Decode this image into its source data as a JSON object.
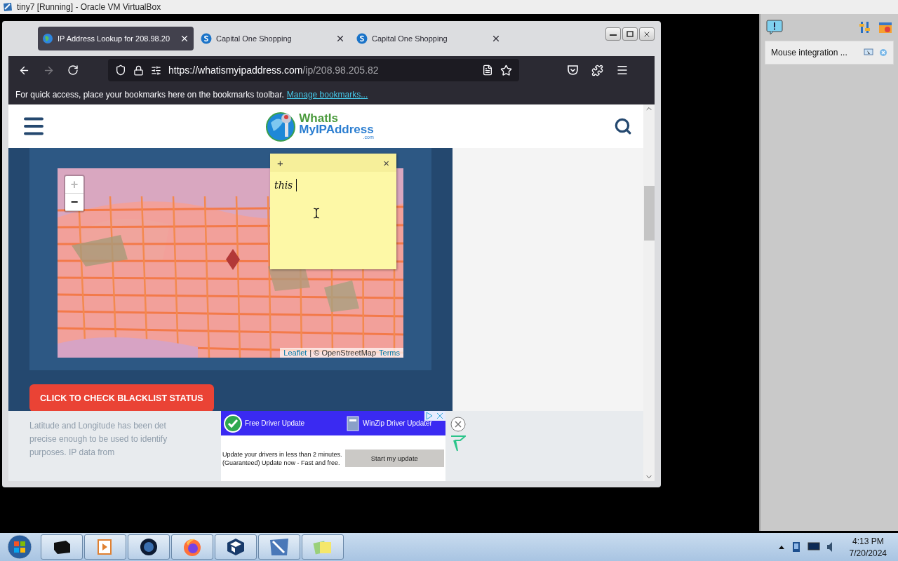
{
  "vbox": {
    "title": "tiny7 [Running] - Oracle VM VirtualBox",
    "notice": "Mouse integration ..."
  },
  "browser": {
    "tabs": [
      {
        "label": "IP Address Lookup for 208.98.20",
        "kind": "globe",
        "selected": true
      },
      {
        "label": "Capital One Shopping",
        "kind": "shopping",
        "selected": false
      },
      {
        "label": "Capital One Shopping",
        "kind": "shopping",
        "selected": false
      }
    ],
    "url_host": "https://whatismyipaddress.com",
    "url_path": "/ip/208.98.205.82",
    "bookmarks_hint": "For quick access, place your bookmarks here on the bookmarks toolbar.",
    "bookmarks_link": "Manage bookmarks..."
  },
  "site": {
    "logo_top": "WhatIs",
    "logo_bottom": "MyIPAddress",
    "logo_suffix": ".com",
    "zoom_in": "+",
    "zoom_out": "−",
    "attribution_link": "Leaflet",
    "attribution_text": "| © OpenStreetMap",
    "attribution_terms": "Terms",
    "blacklist_button": "CLICK TO CHECK BLACKLIST STATUS",
    "faded_lines": [
      "Latitude and Longitude has been det",
      "precise enough to be used to identify",
      "purposes. IP data from"
    ]
  },
  "ad": {
    "left": "Free Driver Update",
    "right": "WinZip Driver Updater",
    "body_lines": [
      "Update your drivers in less than 2 minutes.",
      "(Guaranteed) Update now - Fast and free."
    ],
    "cta": "Start my update"
  },
  "sticky_note": {
    "add": "+",
    "close": "×",
    "text": "this"
  },
  "taskbar": {
    "time": "4:13 PM",
    "date": "7/20/2024"
  }
}
